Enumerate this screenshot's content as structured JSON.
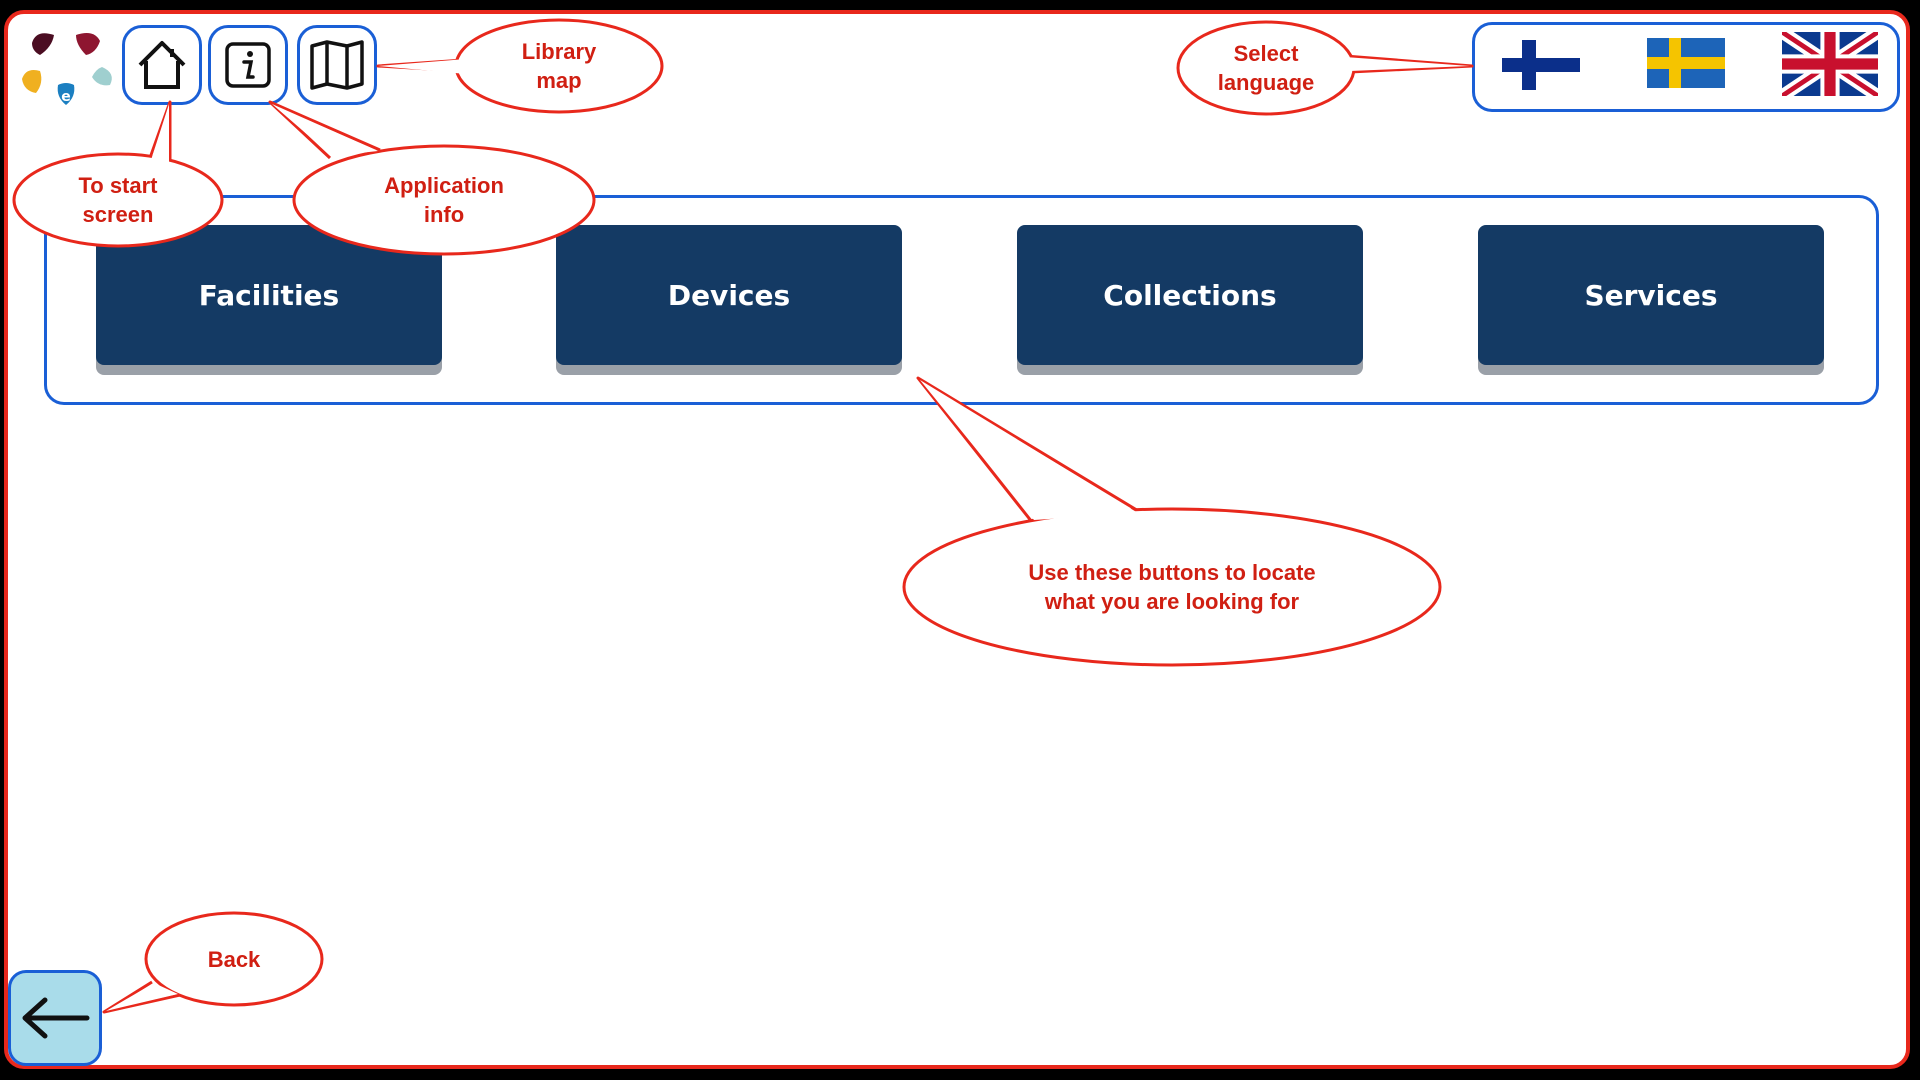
{
  "toolbar": {
    "home_icon": "home-icon",
    "info_icon": "info-icon",
    "map_icon": "map-icon"
  },
  "languages": [
    {
      "name": "finnish-flag-icon"
    },
    {
      "name": "swedish-flag-icon"
    },
    {
      "name": "uk-flag-icon"
    }
  ],
  "categories": {
    "facilities": "Facilities",
    "devices": "Devices",
    "collections": "Collections",
    "services": "Services"
  },
  "callouts": {
    "library_map": "Library\nmap",
    "select_language": "Select\nlanguage",
    "to_start_screen": "To start\nscreen",
    "application_info": "Application\ninfo",
    "locate_buttons": "Use these buttons to locate\nwhat you are looking for",
    "back": "Back"
  },
  "colors": {
    "accent_border": "#1a5fd6",
    "button_navy": "#143a64",
    "callout_red": "#e8281c",
    "back_button_bg": "#a9dcea"
  }
}
